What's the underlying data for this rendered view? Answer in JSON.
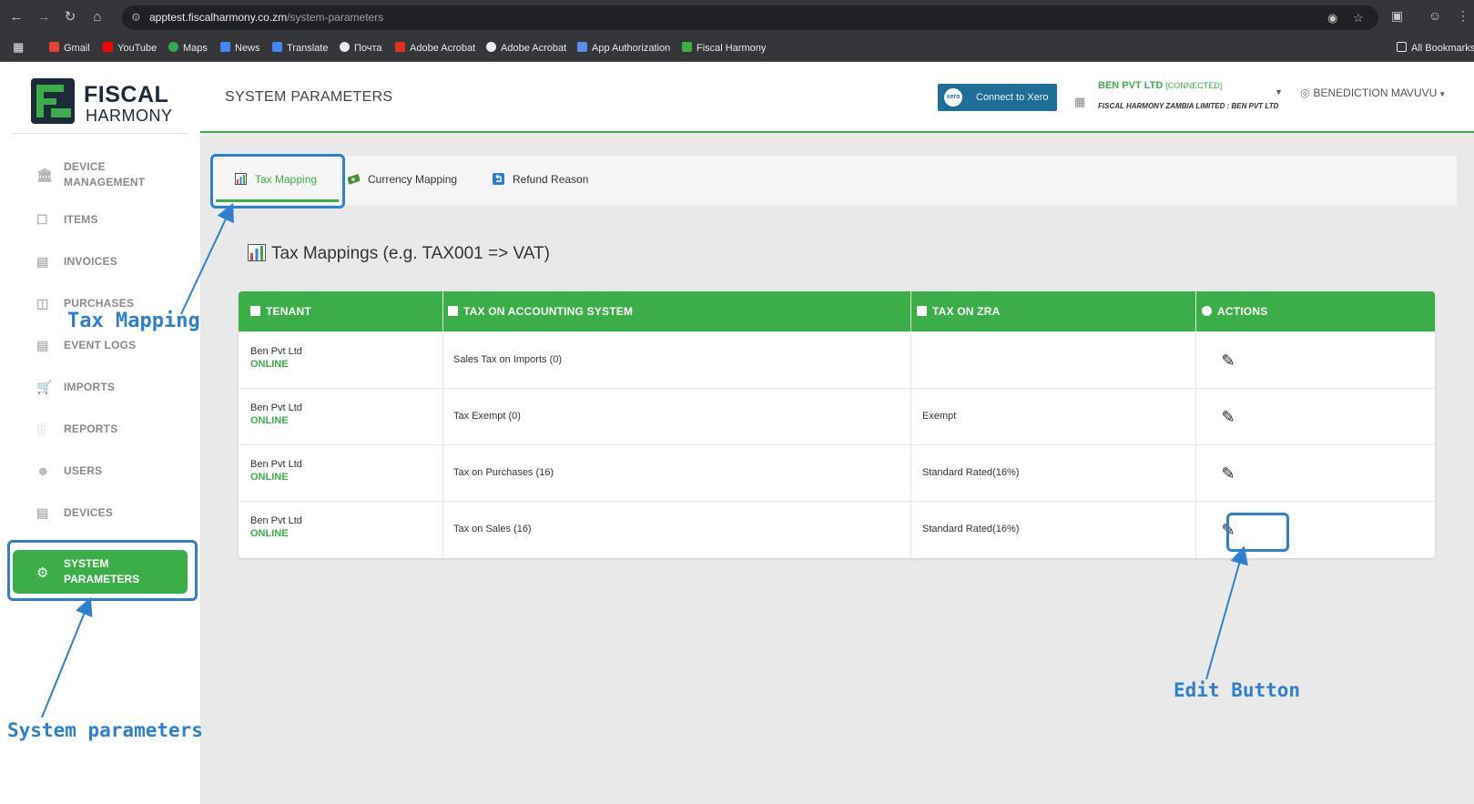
{
  "browser": {
    "url_host": "apptest.fiscalharmony.co.zm",
    "url_path": "/system-parameters",
    "bookmarks": [
      "Gmail",
      "YouTube",
      "Maps",
      "News",
      "Translate",
      "Почта",
      "Adobe Acrobat",
      "Adobe Acrobat",
      "App Authorization",
      "Fiscal Harmony"
    ],
    "all_bookmarks": "All Bookmarks"
  },
  "logo": {
    "line1": "FISCAL",
    "line2": "HARMONY"
  },
  "sidebar": {
    "items": [
      {
        "label": "DEVICE\nMANAGEMENT",
        "icon": "bank-icon"
      },
      {
        "label": "ITEMS",
        "icon": "box-icon"
      },
      {
        "label": "INVOICES",
        "icon": "invoice-icon"
      },
      {
        "label": "PURCHASES",
        "icon": "basket-icon"
      },
      {
        "label": "EVENT LOGS",
        "icon": "log-icon"
      },
      {
        "label": "IMPORTS",
        "icon": "cart-icon"
      },
      {
        "label": "REPORTS",
        "icon": "chart-icon"
      },
      {
        "label": "USERS",
        "icon": "user-icon"
      },
      {
        "label": "DEVICES",
        "icon": "device-icon"
      }
    ],
    "active": {
      "line1": "SYSTEM",
      "line2": "PARAMETERS",
      "icon": "gear-icon"
    }
  },
  "header": {
    "title": "SYSTEM PARAMETERS",
    "xero_button": "Connect to Xero",
    "xero_logo": "xero",
    "org_name": "BEN PVT LTD",
    "org_status": "[CONNECTED]",
    "org_sub": "FISCAL HARMONY ZAMBIA LIMITED : BEN PVT LTD",
    "user": "BENEDICTION MAVUVU"
  },
  "tabs": [
    {
      "label": "Tax Mapping",
      "active": true
    },
    {
      "label": "Currency Mapping",
      "active": false
    },
    {
      "label": "Refund Reason",
      "active": false
    }
  ],
  "section_title": "Tax Mappings (e.g. TAX001 => VAT)",
  "table": {
    "headers": [
      "TENANT",
      "TAX ON ACCOUNTING SYSTEM",
      "TAX ON ZRA",
      "ACTIONS"
    ],
    "rows": [
      {
        "tenant": "Ben Pvt Ltd",
        "status": "ONLINE",
        "accounting_tax": "Sales Tax on Imports (0)",
        "zra_tax": ""
      },
      {
        "tenant": "Ben Pvt Ltd",
        "status": "ONLINE",
        "accounting_tax": "Tax Exempt (0)",
        "zra_tax": "Exempt"
      },
      {
        "tenant": "Ben Pvt Ltd",
        "status": "ONLINE",
        "accounting_tax": "Tax on Purchases (16)",
        "zra_tax": "Standard Rated(16%)"
      },
      {
        "tenant": "Ben Pvt Ltd",
        "status": "ONLINE",
        "accounting_tax": "Tax on Sales (16)",
        "zra_tax": "Standard Rated(16%)"
      }
    ]
  },
  "annotations": {
    "tax_mapping": "Tax Mapping",
    "system_parameters": "System parameters",
    "edit_button": "Edit Button"
  },
  "colors": {
    "accent": "#3cae48",
    "annotation": "#2f7fd1",
    "xero": "#1f6e98"
  }
}
